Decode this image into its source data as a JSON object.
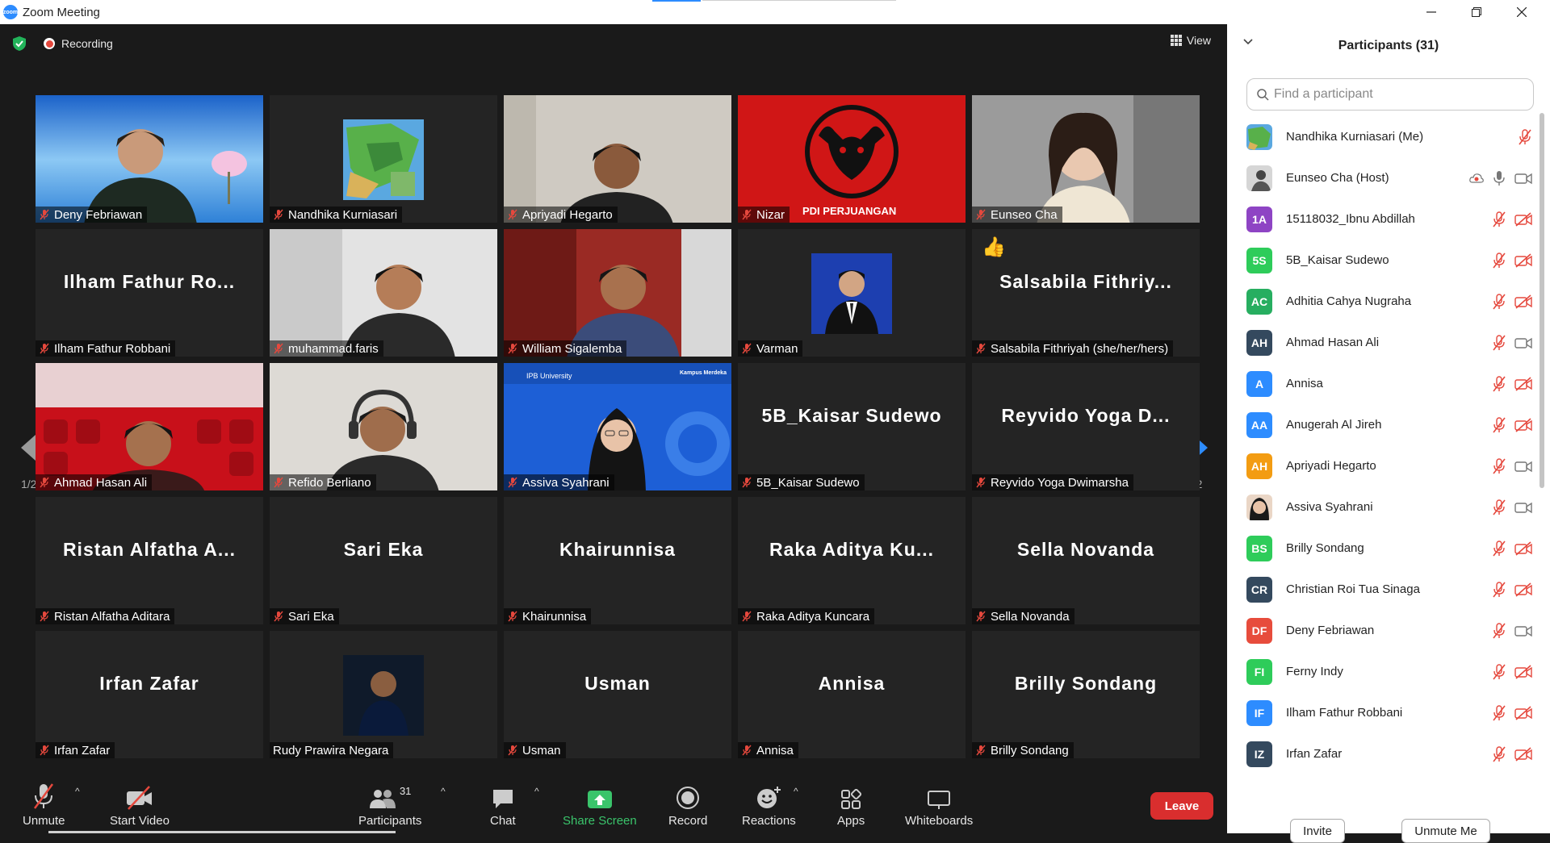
{
  "window": {
    "title": "Zoom Meeting",
    "app_icon_text": "zoom"
  },
  "meeting": {
    "recording_label": "Recording",
    "view_label": "View",
    "page_indicator": "1/2"
  },
  "tiles": [
    {
      "name": "Deny Febriawan",
      "kind": "video",
      "scene": "sky"
    },
    {
      "name": "Nandhika Kurniasari",
      "kind": "image",
      "scene": "map"
    },
    {
      "name": "Apriyadi Hegarto",
      "kind": "video",
      "scene": "room"
    },
    {
      "name": "Nizar",
      "kind": "image",
      "scene": "pdi",
      "logo_text": "PDI PERJUANGAN"
    },
    {
      "name": "Eunseo Cha",
      "kind": "video",
      "scene": "host",
      "active": true
    },
    {
      "name": "Ilham Fathur Robbani",
      "kind": "name",
      "big": "Ilham  Fathur  Ro..."
    },
    {
      "name": "muhammad.faris",
      "kind": "video",
      "scene": "faris"
    },
    {
      "name": "William Sigalemba",
      "kind": "video",
      "scene": "curtain"
    },
    {
      "name": "Varman",
      "kind": "image",
      "scene": "portrait"
    },
    {
      "name": "Salsabila Fithriyah (she/her/hers)",
      "kind": "name",
      "big": "Salsabila  Fithriy...",
      "reaction": "👍"
    },
    {
      "name": "Ahmad Hasan Ali",
      "kind": "video",
      "scene": "theater"
    },
    {
      "name": "Refido Berliano",
      "kind": "video",
      "scene": "headset"
    },
    {
      "name": "Assiva Syahrani",
      "kind": "video",
      "scene": "ipb",
      "bg_text": "IPB University",
      "bg_text2": "Kampus Merdeka"
    },
    {
      "name": "5B_Kaisar Sudewo",
      "kind": "name",
      "big": "5B_Kaisar  Sudewo"
    },
    {
      "name": "Reyvido Yoga Dwimarsha",
      "kind": "name",
      "big": "Reyvido  Yoga  D..."
    },
    {
      "name": "Ristan Alfatha Aditara",
      "kind": "name",
      "big": "Ristan  Alfatha  A..."
    },
    {
      "name": "Sari Eka",
      "kind": "name",
      "big": "Sari  Eka"
    },
    {
      "name": "Khairunnisa",
      "kind": "name",
      "big": "Khairunnisa"
    },
    {
      "name": "Raka Aditya Kuncara",
      "kind": "name",
      "big": "Raka  Aditya  Ku..."
    },
    {
      "name": "Sella Novanda",
      "kind": "name",
      "big": "Sella  Novanda"
    },
    {
      "name": "Irfan Zafar",
      "kind": "name",
      "big": "Irfan  Zafar"
    },
    {
      "name": "Rudy Prawira Negara",
      "kind": "image",
      "scene": "rudy",
      "mic_on": true
    },
    {
      "name": "Usman",
      "kind": "name",
      "big": "Usman"
    },
    {
      "name": "Annisa",
      "kind": "name",
      "big": "Annisa"
    },
    {
      "name": "Brilly Sondang",
      "kind": "name",
      "big": "Brilly  Sondang"
    }
  ],
  "toolbar": {
    "unmute": "Unmute",
    "start_video": "Start Video",
    "participants": "Participants",
    "participants_count": "31",
    "chat": "Chat",
    "share_screen": "Share Screen",
    "record": "Record",
    "reactions": "Reactions",
    "apps": "Apps",
    "whiteboards": "Whiteboards",
    "leave": "Leave"
  },
  "panel": {
    "title": "Participants (31)",
    "search_placeholder": "Find a participant",
    "invite": "Invite",
    "unmute_me": "Unmute Me",
    "participants": [
      {
        "initials": "",
        "name": "Nandhika Kurniasari (Me)",
        "color": "#5a9a6a",
        "photo": "map",
        "video_icon": "none"
      },
      {
        "initials": "",
        "name": "Eunseo Cha (Host)",
        "color": "#8a8a8a",
        "photo": "host",
        "video_icon": "host"
      },
      {
        "initials": "1A",
        "name": "15118032_Ibnu Abdillah",
        "color": "#8e44c4",
        "video_icon": "off"
      },
      {
        "initials": "5S",
        "name": "5B_Kaisar Sudewo",
        "color": "#2ecc5a",
        "video_icon": "off"
      },
      {
        "initials": "AC",
        "name": "Adhitia Cahya Nugraha",
        "color": "#27ae60",
        "video_icon": "off"
      },
      {
        "initials": "AH",
        "name": "Ahmad Hasan Ali",
        "color": "#34495e",
        "video_icon": "on"
      },
      {
        "initials": "A",
        "name": "Annisa",
        "color": "#2d8cff",
        "video_icon": "off"
      },
      {
        "initials": "AA",
        "name": "Anugerah Al Jireh",
        "color": "#2d8cff",
        "video_icon": "off"
      },
      {
        "initials": "AH",
        "name": "Apriyadi Hegarto",
        "color": "#f39c12",
        "video_icon": "on"
      },
      {
        "initials": "",
        "name": "Assiva Syahrani",
        "color": "#c8a080",
        "photo": "face",
        "video_icon": "on"
      },
      {
        "initials": "BS",
        "name": "Brilly Sondang",
        "color": "#2ecc5a",
        "video_icon": "off"
      },
      {
        "initials": "CR",
        "name": "Christian Roi Tua Sinaga",
        "color": "#34495e",
        "video_icon": "off"
      },
      {
        "initials": "DF",
        "name": "Deny Febriawan",
        "color": "#e74c3c",
        "video_icon": "on"
      },
      {
        "initials": "FI",
        "name": "Ferny Indy",
        "color": "#2ecc5a",
        "video_icon": "off"
      },
      {
        "initials": "IF",
        "name": "Ilham Fathur Robbani",
        "color": "#2d8cff",
        "video_icon": "off"
      },
      {
        "initials": "IZ",
        "name": "Irfan Zafar",
        "color": "#34495e",
        "video_icon": "off"
      }
    ]
  },
  "colors": {
    "accent": "#2D8CFF",
    "leave": "#d92e2e",
    "share": "#3ac46b",
    "mute_red": "#e5483d",
    "active_border": "#b9d93a"
  }
}
